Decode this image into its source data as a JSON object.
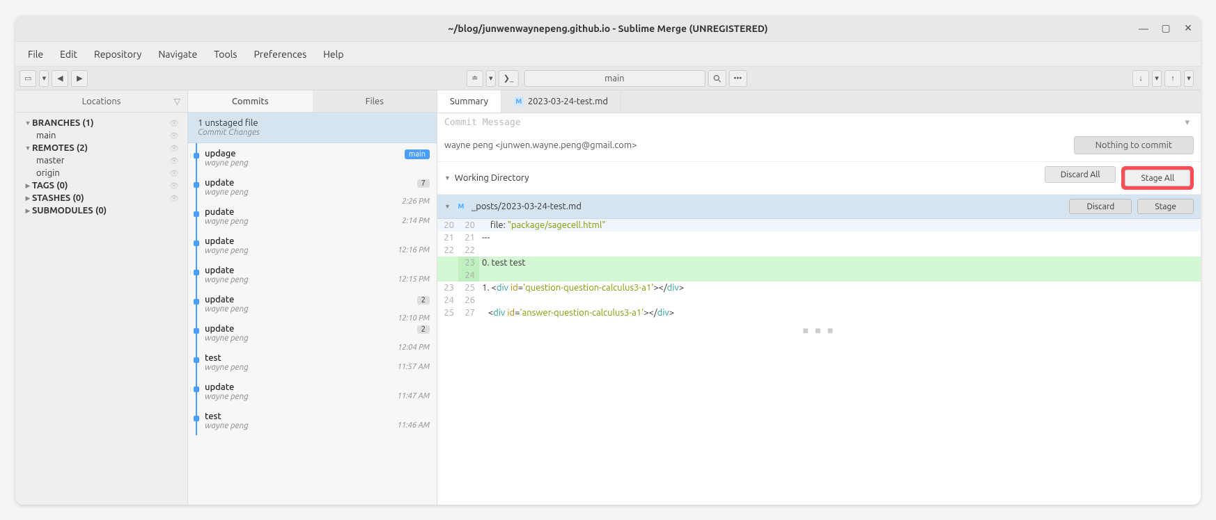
{
  "window": {
    "title": "~/blog/junwenwaynepeng.github.io - Sublime Merge (UNREGISTERED)"
  },
  "menu": {
    "items": [
      "File",
      "Edit",
      "Repository",
      "Navigate",
      "Tools",
      "Preferences",
      "Help"
    ]
  },
  "toolbar": {
    "branch": "main"
  },
  "sidebar": {
    "header": "Locations",
    "groups": [
      {
        "label": "BRANCHES (1)",
        "children": [
          "main"
        ],
        "eye": true
      },
      {
        "label": "REMOTES (2)",
        "children": [
          "master",
          "origin"
        ],
        "eye": true
      },
      {
        "label": "TAGS (0)",
        "children": [],
        "eye": true
      },
      {
        "label": "STASHES (0)",
        "children": [],
        "eye": true
      },
      {
        "label": "SUBMODULES (0)",
        "children": [],
        "eye": false
      }
    ]
  },
  "commitsPanel": {
    "tabs": {
      "commits": "Commits",
      "files": "Files"
    },
    "stage": {
      "title": "1 unstaged file",
      "sub": "Commit Changes"
    },
    "list": [
      {
        "title": "updage",
        "author": "wayne peng",
        "badge_main": "main",
        "time": ""
      },
      {
        "title": "update",
        "author": "wayne peng",
        "badge_count": "7",
        "time": "2:26 PM"
      },
      {
        "title": "pudate",
        "author": "wayne peng",
        "time": "2:14 PM"
      },
      {
        "title": "update",
        "author": "wayne peng",
        "time": "12:16 PM"
      },
      {
        "title": "update",
        "author": "wayne peng",
        "time": "12:15 PM"
      },
      {
        "title": "update",
        "author": "wayne peng",
        "badge_count": "2",
        "time": "12:10 PM"
      },
      {
        "title": "update",
        "author": "wayne peng",
        "badge_count": "2",
        "time": "12:04 PM"
      },
      {
        "title": "test",
        "author": "wayne peng",
        "time": "11:57 AM"
      },
      {
        "title": "update",
        "author": "wayne peng",
        "time": "11:47 AM"
      },
      {
        "title": "test",
        "author": "wayne peng",
        "time": "11:46 AM"
      }
    ]
  },
  "detail": {
    "tabs": {
      "summary": "Summary",
      "file": "2023-03-24-test.md"
    },
    "commitPlaceholder": "Commit Message",
    "author": "wayne peng <junwen.wayne.peng@gmail.com>",
    "commitBtn": "Nothing to commit",
    "workingDir": "Working Directory",
    "discardAll": "Discard All",
    "stageAll": "Stage All",
    "filePath": "_posts/2023-03-24-test.md",
    "discard": "Discard",
    "stage": "Stage"
  },
  "diff": {
    "lines": [
      {
        "old": "20",
        "new": "20",
        "cls": "diff-header",
        "html": "    file: <span class='str'>\"package/sagecell.html\"</span>"
      },
      {
        "old": "21",
        "new": "21",
        "cls": "",
        "text": "---"
      },
      {
        "old": "22",
        "new": "22",
        "cls": "",
        "text": ""
      },
      {
        "old": "",
        "new": "23",
        "cls": "diff-add",
        "text": "0. test test"
      },
      {
        "old": "",
        "new": "24",
        "cls": "diff-add",
        "text": ""
      },
      {
        "old": "23",
        "new": "25",
        "cls": "",
        "html": "1. <span class='punct'>&lt;</span><span class='tag'>div</span> <span class='attr'>id</span>=<span class='str'>'question-question-calculus3-a1'</span><span class='punct'>&gt;&lt;/</span><span class='tag'>div</span><span class='punct'>&gt;</span>"
      },
      {
        "old": "24",
        "new": "26",
        "cls": "",
        "text": ""
      },
      {
        "old": "25",
        "new": "27",
        "cls": "",
        "html": "   <span class='punct'>&lt;</span><span class='tag'>div</span> <span class='attr'>id</span>=<span class='str'>'answer-question-calculus3-a1'</span><span class='punct'>&gt;&lt;/</span><span class='tag'>div</span><span class='punct'>&gt;</span>"
      }
    ]
  }
}
